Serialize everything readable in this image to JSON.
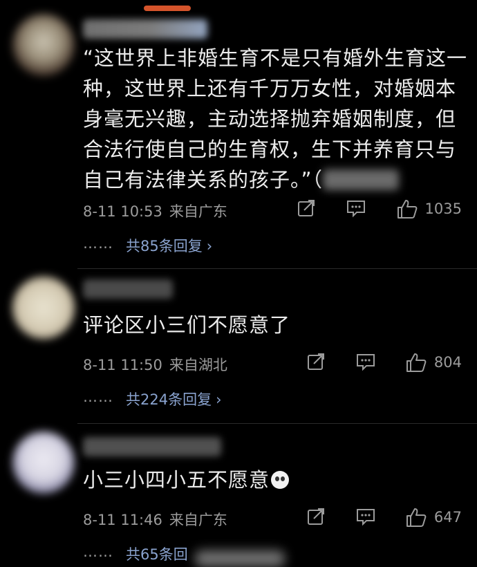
{
  "colors": {
    "background": "#000000",
    "text": "#ececec",
    "meta": "#9c9c9c",
    "link": "#8aa3cf",
    "accent": "#d4542b"
  },
  "comments": [
    {
      "text": "“这世界上非婚生育不是只有婚外生育这一种，这世界上还有千万万女性，对婚姻本身毫无兴趣，主动选择抛弃婚姻制度，但合法行使自己的生育权，生下并养育只与自己有法律关系的孩子。”（",
      "time": "8-11 10:53",
      "location": "来自广东",
      "likes": "1035",
      "replies_label": "共85条回复",
      "dots": "……",
      "chevron": "›"
    },
    {
      "text": "评论区小三们不愿意了",
      "time": "8-11 11:50",
      "location": "来自湖北",
      "likes": "804",
      "replies_label": "共224条回复",
      "dots": "……",
      "chevron": "›"
    },
    {
      "text": "小三小四小五不愿意",
      "time": "8-11 11:46",
      "location": "来自广东",
      "likes": "647",
      "replies_label": "共65条回",
      "dots": "……",
      "emoji": "surprised-face-emoji"
    }
  ],
  "icons": {
    "share": "share-icon",
    "reply": "comment-icon",
    "like": "thumbs-up-icon"
  }
}
